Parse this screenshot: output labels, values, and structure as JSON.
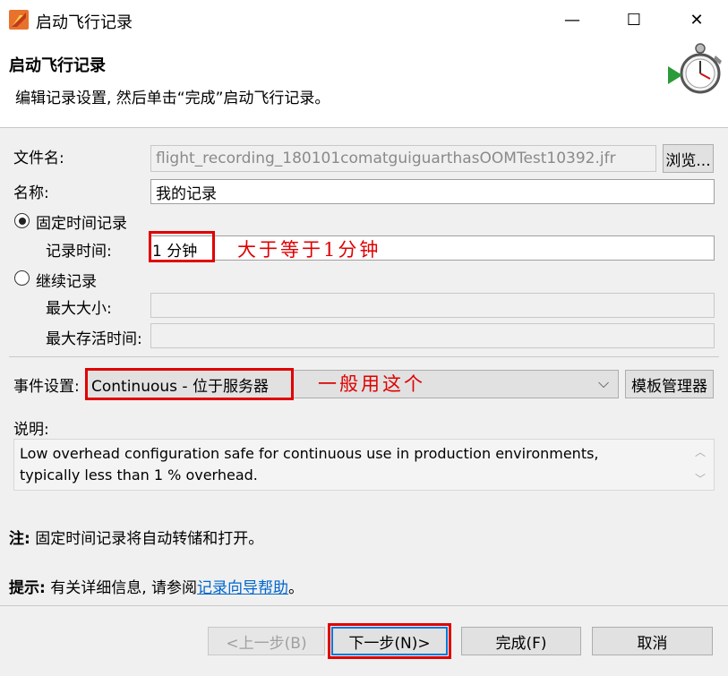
{
  "window": {
    "title": "启动飞行记录",
    "minimize": "—",
    "maximize": "☐",
    "close": "✕"
  },
  "header": {
    "title": "启动飞行记录",
    "description": "编辑记录设置, 然后单击“完成”启动飞行记录。"
  },
  "form": {
    "file_label": "文件名:",
    "file_value": "flight_recording_180101comatguiguarthasOOMTest10392.jfr",
    "browse_button": "浏览...",
    "name_label": "名称:",
    "name_value": "我的记录",
    "fixed_radio_label": "固定时间记录",
    "record_time_label": "记录时间:",
    "record_time_value": "1 分钟",
    "continuous_radio_label": "继续记录",
    "max_size_label": "最大大小:",
    "max_age_label": "最大存活时间:",
    "event_label": "事件设置:",
    "event_value": "Continuous - 位于服务器",
    "template_button": "模板管理器",
    "desc_label": "说明:",
    "desc_line1": "Low overhead configuration safe for continuous use in production environments,",
    "desc_line2": "typically less than 1 % overhead."
  },
  "annotations": {
    "time_note": "大于等于1分钟",
    "event_note": "一般用这个"
  },
  "notes": {
    "note_label": "注:",
    "note_text": " 固定时间记录将自动转储和打开。",
    "hint_label": "提示:",
    "hint_text": " 有关详细信息, 请参阅",
    "hint_link": "记录向导帮助",
    "hint_end": "。"
  },
  "footer": {
    "back_button": "<上一步(B)",
    "next_button": "下一步(N)>",
    "finish_button": "完成(F)",
    "cancel_button": "取消"
  },
  "colors": {
    "annotation_red": "#e00000",
    "link_blue": "#0066cc"
  }
}
